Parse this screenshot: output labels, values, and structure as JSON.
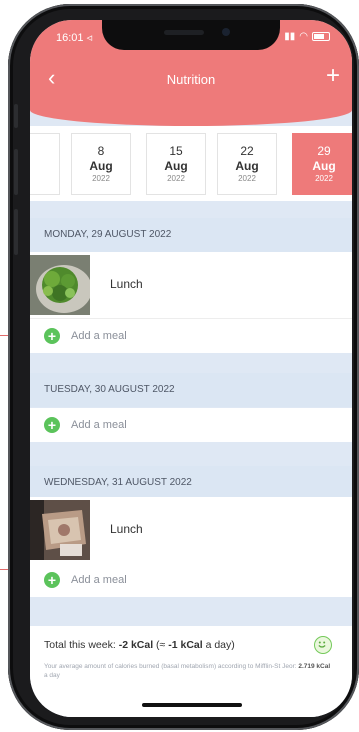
{
  "status_bar": {
    "time": "16:01 ◃"
  },
  "nav": {
    "title": "Nutrition",
    "back_icon": "chevron-left-icon",
    "add_icon": "plus-icon"
  },
  "weeks": [
    {
      "day": "",
      "month": "",
      "year": ""
    },
    {
      "day": "8",
      "month": "Aug",
      "year": "2022"
    },
    {
      "day": "15",
      "month": "Aug",
      "year": "2022"
    },
    {
      "day": "22",
      "month": "Aug",
      "year": "2022"
    },
    {
      "day": "29",
      "month": "Aug",
      "year": "2022",
      "selected": true
    }
  ],
  "days": [
    {
      "header": "MONDAY, 29 AUGUST 2022",
      "meals": [
        {
          "label": "Lunch"
        }
      ],
      "add_label": "Add a meal"
    },
    {
      "header": "TUESDAY, 30 AUGUST 2022",
      "meals": [],
      "add_label": "Add a meal"
    },
    {
      "header": "WEDNESDAY, 31 AUGUST 2022",
      "meals": [
        {
          "label": "Lunch"
        }
      ],
      "add_label": "Add a meal"
    }
  ],
  "footer": {
    "total_prefix": "Total this week: ",
    "total_value": "-2 kCal",
    "total_mid": " (≈ ",
    "daily_value": "-1 kCal",
    "total_suffix": " a day)",
    "note_text": "Your average amount of calories burned (basal metabolism) according to Mifflin-St Jeor: ",
    "note_value": "2.719 kCal",
    "note_suffix": " a day"
  },
  "colors": {
    "accent": "#ee7a7a",
    "add_green": "#5bc35b",
    "day_header_bg": "#dbe6f3"
  }
}
